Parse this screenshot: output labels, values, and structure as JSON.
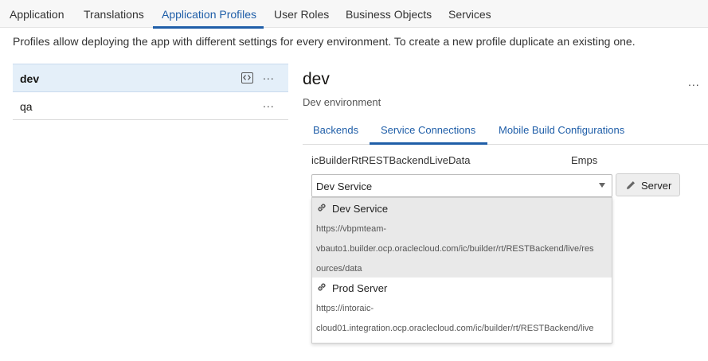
{
  "top_tabs": [
    {
      "label": "Application"
    },
    {
      "label": "Translations"
    },
    {
      "label": "Application Profiles"
    },
    {
      "label": "User Roles"
    },
    {
      "label": "Business Objects"
    },
    {
      "label": "Services"
    }
  ],
  "active_top_tab": "Application Profiles",
  "description": "Profiles allow deploying the app with different settings for every environment. To create a new profile duplicate an existing one.",
  "profiles": [
    {
      "name": "dev",
      "selected": true,
      "more": "..."
    },
    {
      "name": "qa",
      "selected": false,
      "more": "..."
    }
  ],
  "detail": {
    "title": "dev",
    "more": "...",
    "subtitle": "Dev environment",
    "tabs": [
      {
        "label": "Backends"
      },
      {
        "label": "Service Connections"
      },
      {
        "label": "Mobile Build Configurations"
      }
    ],
    "active_tab": "Service Connections",
    "connection": {
      "name": "icBuilderRtRESTBackendLiveData",
      "target": "Emps",
      "selected_server": "Dev Service",
      "server_button": "Server"
    },
    "options": [
      {
        "title": "Dev Service",
        "url_lines": [
          "https://vbpmteam-",
          "vbauto1.builder.ocp.oraclecloud.com/ic/builder/rt/RESTBackend/live/res",
          "ources/data"
        ]
      },
      {
        "title": "Prod Server",
        "url_lines": [
          "https://intoraic-",
          "cloud01.integration.ocp.oraclecloud.com/ic/builder/rt/RESTBackend/live"
        ]
      }
    ]
  },
  "colors": {
    "accent": "#1f5ea8",
    "selected_row": "#e4eff9",
    "highlight_option": "#e9e9e9"
  },
  "icons": [
    "code-icon",
    "more-icon",
    "chevron-down-icon",
    "pencil-icon",
    "link-icon"
  ]
}
